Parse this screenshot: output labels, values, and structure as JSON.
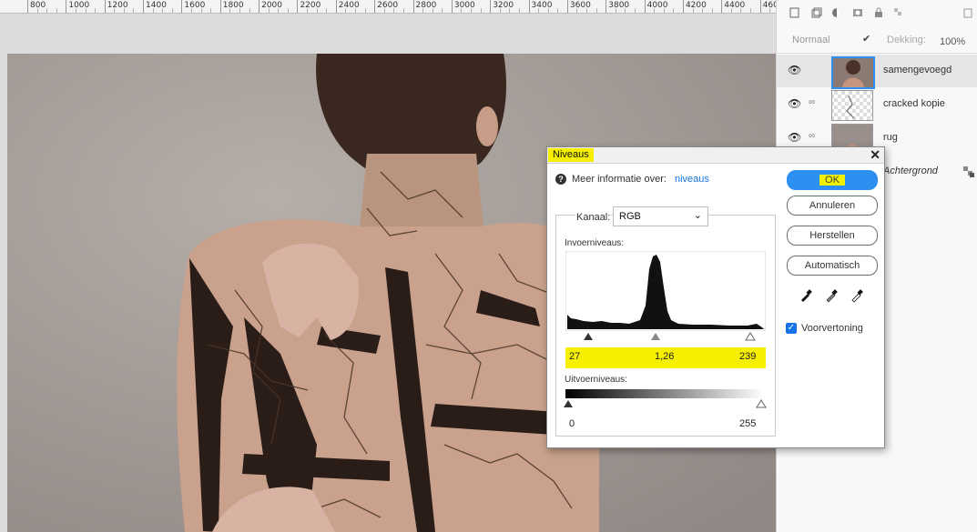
{
  "ruler": {
    "labels": [
      "800",
      "1000",
      "1200",
      "1400",
      "1600",
      "1800",
      "2000",
      "2200",
      "2400",
      "2600",
      "2800",
      "3000",
      "3200",
      "3400",
      "3600",
      "3800",
      "4000",
      "4200",
      "4400",
      "460"
    ]
  },
  "layers_panel": {
    "blend_mode": "Normaal",
    "opacity_label": "Dekking:",
    "opacity_value": "100%",
    "layers": [
      {
        "name": "samengevoegd"
      },
      {
        "name": "cracked kopie"
      },
      {
        "name": "rug"
      },
      {
        "name": "Achtergrond"
      }
    ]
  },
  "dialog": {
    "title": "Niveaus",
    "info_text": "Meer informatie over:",
    "info_link": "niveaus",
    "channel_label": "Kanaal:",
    "channel_value": "RGB",
    "input_levels_label": "Invoerniveaus:",
    "input_black": "27",
    "input_gamma": "1,26",
    "input_white": "239",
    "output_levels_label": "Uitvoerniveaus:",
    "output_black": "0",
    "output_white": "255",
    "ok_label": "OK",
    "cancel_label": "Annuleren",
    "reset_label": "Herstellen",
    "auto_label": "Automatisch",
    "preview_label": "Voorvertoning",
    "preview_checked": true
  },
  "colors": {
    "highlight": "#f6f000",
    "ok_button": "#2d8ff0",
    "link": "#1473e6"
  }
}
